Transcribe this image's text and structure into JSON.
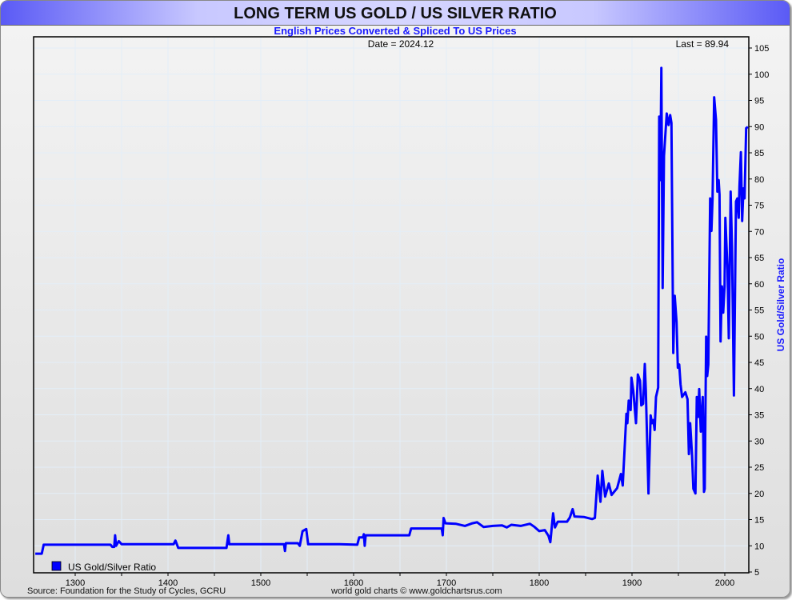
{
  "header": {
    "title": "LONG TERM US GOLD / US SILVER RATIO",
    "subtitle": "English Prices Converted & Spliced To US Prices"
  },
  "footer": {
    "source": "Source: Foundation for the Study of Cycles, GCRU",
    "credit": "world gold charts © www.goldchartsrus.com"
  },
  "chart_data": {
    "type": "line",
    "title": "LONG TERM US GOLD / US SILVER RATIO",
    "date_label": "Date = 2024.12",
    "last_label": "Last = 89.94",
    "xlabel": "",
    "ylabel": "US Gold/Silver Ratio",
    "xlim": [
      1255,
      2026
    ],
    "ylim": [
      5,
      107
    ],
    "x_ticks": [
      1300,
      1400,
      1500,
      1600,
      1700,
      1800,
      1900,
      2000
    ],
    "y_ticks": [
      5,
      10,
      15,
      20,
      25,
      30,
      35,
      40,
      45,
      50,
      55,
      60,
      65,
      70,
      75,
      80,
      85,
      90,
      95,
      100,
      105
    ],
    "grid": true,
    "legend": {
      "position": "bottom-left",
      "entries": [
        "US Gold/Silver Ratio"
      ]
    },
    "color": "#0000ff",
    "series": [
      {
        "name": "US Gold/Silver Ratio",
        "points": [
          [
            1257,
            8.5
          ],
          [
            1264,
            8.5
          ],
          [
            1266,
            10.2
          ],
          [
            1338,
            10.2
          ],
          [
            1340,
            9.8
          ],
          [
            1342,
            9.8
          ],
          [
            1343,
            12.0
          ],
          [
            1344,
            10.0
          ],
          [
            1347,
            10.9
          ],
          [
            1350,
            10.3
          ],
          [
            1406,
            10.3
          ],
          [
            1408,
            11.0
          ],
          [
            1411,
            9.6
          ],
          [
            1463,
            9.6
          ],
          [
            1465,
            12.0
          ],
          [
            1466,
            10.3
          ],
          [
            1525,
            10.3
          ],
          [
            1526,
            9.0
          ],
          [
            1527,
            10.5
          ],
          [
            1540,
            10.5
          ],
          [
            1542,
            10.0
          ],
          [
            1545,
            12.8
          ],
          [
            1549,
            13.2
          ],
          [
            1551,
            10.3
          ],
          [
            1585,
            10.3
          ],
          [
            1604,
            10.2
          ],
          [
            1606,
            11.6
          ],
          [
            1610,
            11.6
          ],
          [
            1611,
            12.2
          ],
          [
            1612,
            10.0
          ],
          [
            1613,
            12.0
          ],
          [
            1660,
            12.0
          ],
          [
            1662,
            13.3
          ],
          [
            1695,
            13.3
          ],
          [
            1696,
            12.0
          ],
          [
            1697,
            15.3
          ],
          [
            1699,
            14.3
          ],
          [
            1710,
            14.2
          ],
          [
            1720,
            13.8
          ],
          [
            1728,
            14.3
          ],
          [
            1733,
            14.5
          ],
          [
            1740,
            13.6
          ],
          [
            1750,
            13.8
          ],
          [
            1760,
            13.9
          ],
          [
            1765,
            13.5
          ],
          [
            1770,
            14.0
          ],
          [
            1780,
            13.8
          ],
          [
            1790,
            14.2
          ],
          [
            1795,
            13.6
          ],
          [
            1800,
            12.8
          ],
          [
            1806,
            13.0
          ],
          [
            1810,
            11.9
          ],
          [
            1812,
            10.7
          ],
          [
            1815,
            16.2
          ],
          [
            1817,
            13.5
          ],
          [
            1820,
            14.6
          ],
          [
            1830,
            14.6
          ],
          [
            1833,
            15.4
          ],
          [
            1836,
            17.0
          ],
          [
            1838,
            15.6
          ],
          [
            1848,
            15.5
          ],
          [
            1857,
            15.1
          ],
          [
            1860,
            15.3
          ],
          [
            1863,
            23.4
          ],
          [
            1866,
            18.4
          ],
          [
            1868,
            24.3
          ],
          [
            1871,
            19.4
          ],
          [
            1875,
            21.9
          ],
          [
            1878,
            19.7
          ],
          [
            1884,
            21.0
          ],
          [
            1888,
            23.7
          ],
          [
            1890,
            21.5
          ],
          [
            1894,
            35.2
          ],
          [
            1895,
            33.4
          ],
          [
            1896.5,
            37.7
          ],
          [
            1898.5,
            35.9
          ],
          [
            1899.4,
            42.1
          ],
          [
            1901.4,
            39.6
          ],
          [
            1904.3,
            33.4
          ],
          [
            1906.3,
            42.7
          ],
          [
            1908.6,
            41.5
          ],
          [
            1910,
            36.8
          ],
          [
            1912,
            37.1
          ],
          [
            1913.8,
            44.7
          ],
          [
            1914.9,
            39.6
          ],
          [
            1917.8,
            20.0
          ],
          [
            1920.1,
            34.9
          ],
          [
            1921.5,
            33.4
          ],
          [
            1923,
            34.0
          ],
          [
            1924.4,
            32.1
          ],
          [
            1925.9,
            38.4
          ],
          [
            1928.2,
            40.2
          ],
          [
            1929.3,
            91.9
          ],
          [
            1930.5,
            79.8
          ],
          [
            1931.6,
            101.2
          ],
          [
            1933,
            59.2
          ],
          [
            1934.5,
            84.4
          ],
          [
            1937.4,
            92.5
          ],
          [
            1939.4,
            90.3
          ],
          [
            1941.1,
            92.2
          ],
          [
            1942.5,
            90.7
          ],
          [
            1944.5,
            46.8
          ],
          [
            1946,
            57.7
          ],
          [
            1948,
            52.7
          ],
          [
            1949.4,
            44.0
          ],
          [
            1950.9,
            44.6
          ],
          [
            1952.3,
            40.8
          ],
          [
            1954,
            38.4
          ],
          [
            1957.5,
            39.3
          ],
          [
            1959.8,
            38.0
          ],
          [
            1961.3,
            27.5
          ],
          [
            1962.7,
            33.4
          ],
          [
            1964.7,
            27.1
          ],
          [
            1966.1,
            20.9
          ],
          [
            1968.4,
            20.0
          ],
          [
            1969.8,
            38.4
          ],
          [
            1971.3,
            34.6
          ],
          [
            1972.4,
            39.9
          ],
          [
            1974.1,
            31.8
          ],
          [
            1976.2,
            38.4
          ],
          [
            1977.6,
            20.3
          ],
          [
            1978.4,
            20.9
          ],
          [
            1979.9,
            49.9
          ],
          [
            1981,
            42.4
          ],
          [
            1982.2,
            44.6
          ],
          [
            1984.2,
            76.3
          ],
          [
            1985.6,
            70.1
          ],
          [
            1986.8,
            76.3
          ],
          [
            1988.5,
            95.6
          ],
          [
            1990.5,
            91.3
          ],
          [
            1992,
            77.6
          ],
          [
            1993.4,
            79.8
          ],
          [
            1994.3,
            77.0
          ],
          [
            1995.4,
            49.0
          ],
          [
            1996.9,
            59.5
          ],
          [
            1998.3,
            54.5
          ],
          [
            1999.7,
            59.5
          ],
          [
            2000.6,
            72.6
          ],
          [
            2002.9,
            62.6
          ],
          [
            2004.3,
            49.6
          ],
          [
            2006.3,
            77.6
          ],
          [
            2007.8,
            67.0
          ],
          [
            2009.8,
            38.7
          ],
          [
            2012.1,
            75.7
          ],
          [
            2013.5,
            76.3
          ],
          [
            2015,
            72.6
          ],
          [
            2015.8,
            78.5
          ],
          [
            2017.3,
            85.1
          ],
          [
            2018.7,
            72.0
          ],
          [
            2020.1,
            78.2
          ],
          [
            2021.3,
            76.3
          ],
          [
            2023,
            89.7
          ],
          [
            2024.9,
            89.94
          ]
        ]
      }
    ]
  }
}
